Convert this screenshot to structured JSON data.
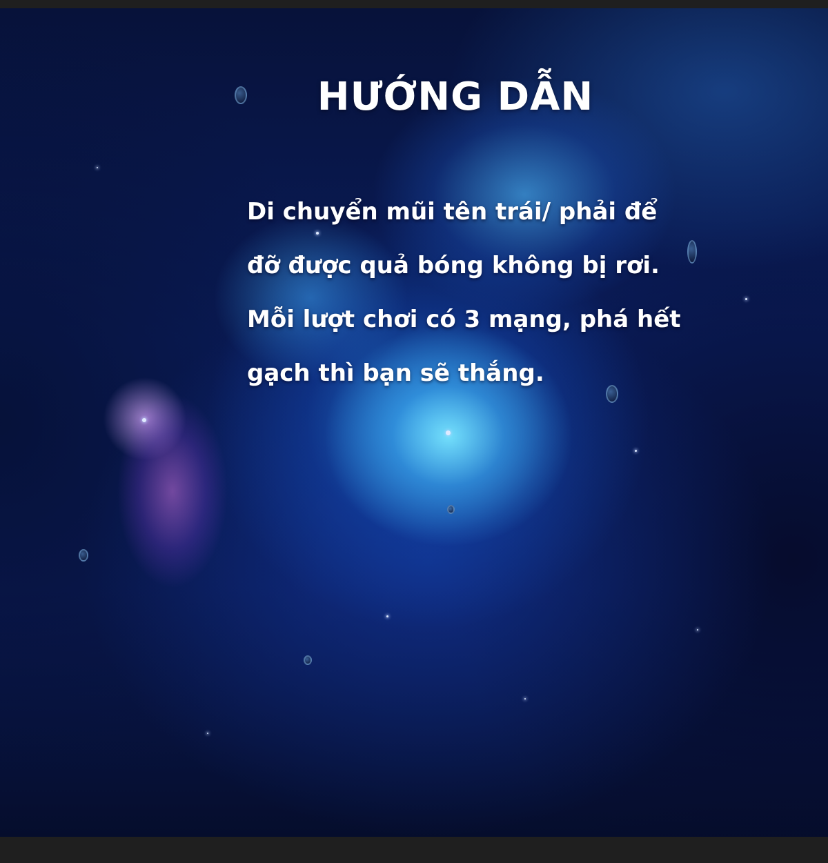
{
  "screen": {
    "title": "HƯỚNG DẪN",
    "instructions": [
      "Di chuyển mũi tên trái/ phải để",
      "đỡ được quả bóng không bị rơi.",
      "Mỗi lượt chơi có 3 mạng, phá hết",
      "gạch thì bạn sẽ thắng."
    ]
  },
  "colors": {
    "text": "#ffffff",
    "page_border": "#1f1f1f",
    "nebula_core": "#78e6ff",
    "space_deep": "#07123a"
  }
}
